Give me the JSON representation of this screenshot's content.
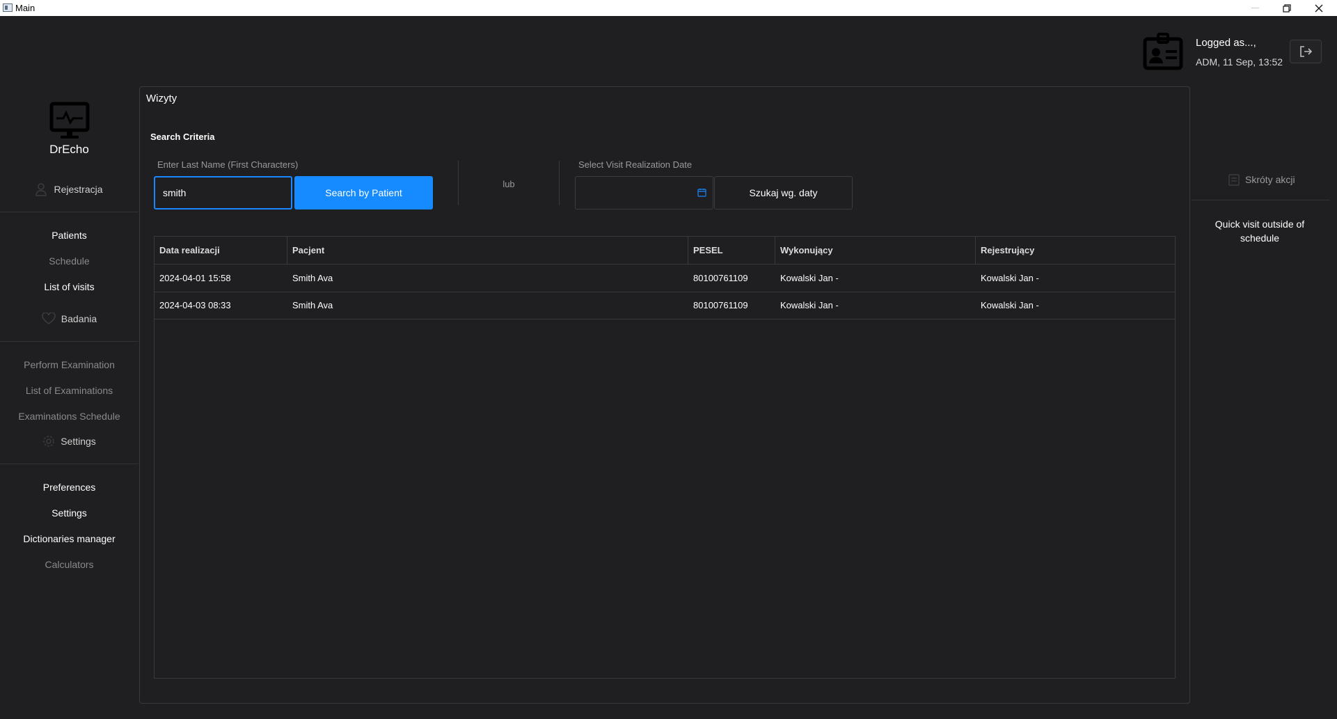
{
  "window": {
    "title": "Main"
  },
  "header": {
    "user_name": "Logged as...,",
    "user_info": "ADM, 11 Sep, 13:52"
  },
  "sidebar": {
    "app_name": "DrEcho",
    "registration": {
      "label": "Rejestracja",
      "items": [
        {
          "label": "Patients",
          "enabled": true
        },
        {
          "label": "Schedule",
          "enabled": false
        },
        {
          "label": "List of visits",
          "enabled": true
        }
      ]
    },
    "examinations": {
      "label": "Badania",
      "items": [
        {
          "label": "Perform Examination",
          "enabled": false
        },
        {
          "label": "List of Examinations",
          "enabled": false
        },
        {
          "label": "Examinations Schedule",
          "enabled": false
        }
      ]
    },
    "settings": {
      "label": "Settings",
      "items": [
        {
          "label": "Preferences",
          "enabled": true
        },
        {
          "label": "Settings",
          "enabled": true
        },
        {
          "label": "Dictionaries manager",
          "enabled": true
        },
        {
          "label": "Calculators",
          "enabled": false
        }
      ]
    }
  },
  "main": {
    "panel_title": "Wizyty",
    "criteria_title": "Search Criteria",
    "lastname_label": "Enter Last Name (First Characters)",
    "lastname_value": "smith",
    "search_patient_label": "Search by Patient",
    "or_label": "lub",
    "date_label": "Select Visit Realization Date",
    "date_value": "",
    "search_date_label": "Szukaj wg. daty",
    "table": {
      "columns": [
        "Data realizacji",
        "Pacjent",
        "PESEL",
        "Wykonujący",
        "Rejestrujący"
      ],
      "rows": [
        [
          "2024-04-01 15:58",
          "Smith Ava",
          "80100761109",
          "Kowalski Jan  -",
          "Kowalski Jan  -"
        ],
        [
          "2024-04-03 08:33",
          "Smith Ava",
          "80100761109",
          "Kowalski Jan  -",
          "Kowalski Jan  -"
        ]
      ]
    }
  },
  "right_panel": {
    "shortcuts_label": "Skróty akcji",
    "quick_visit_label": "Quick visit outside of schedule"
  },
  "colors": {
    "background": "#1f1f21",
    "accent": "#168bff",
    "border": "#3a3a3c",
    "muted_text": "#8a8a8c"
  }
}
